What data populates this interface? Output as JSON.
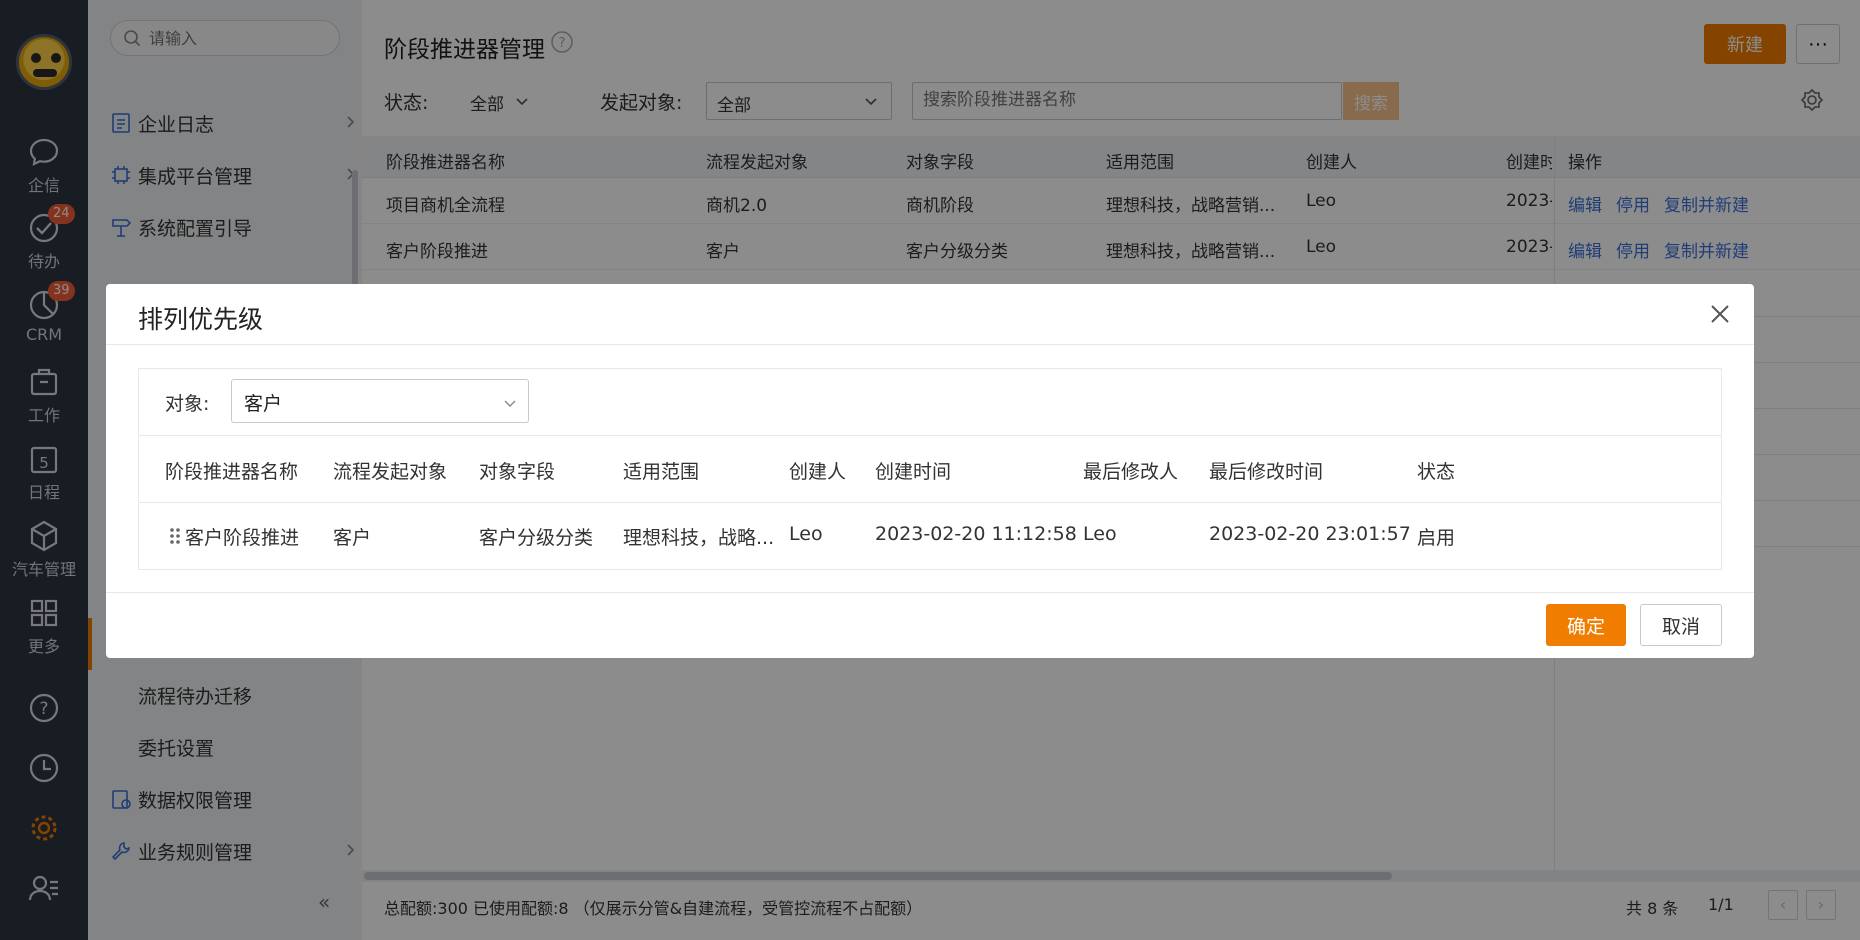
{
  "rail": {
    "items": [
      {
        "label": "企信",
        "icon": "chat-icon"
      },
      {
        "label": "待办",
        "icon": "todo-check-icon",
        "badge": "24"
      },
      {
        "label": "CRM",
        "icon": "crm-pie-icon",
        "badge": "39"
      },
      {
        "label": "工作",
        "icon": "briefcase-icon"
      },
      {
        "label": "日程",
        "icon": "calendar-icon"
      },
      {
        "label": "汽车管理",
        "icon": "cube-icon"
      },
      {
        "label": "更多",
        "icon": "grid-icon"
      }
    ]
  },
  "sidebar": {
    "search_placeholder": "请输入",
    "items_top": [
      {
        "label": "企业日志"
      },
      {
        "label": "集成平台管理"
      },
      {
        "label": "系统配置引导"
      }
    ],
    "items_bottom": [
      {
        "label": "流程待办迁移"
      },
      {
        "label": "委托设置"
      },
      {
        "label": "数据权限管理"
      },
      {
        "label": "业务规则管理"
      }
    ],
    "collapse": "«"
  },
  "main": {
    "title": "阶段推进器管理",
    "new_button": "新建",
    "more_button": "···",
    "status_label": "状态:",
    "status_value": "全部",
    "initiator_label": "发起对象:",
    "initiator_value": "全部",
    "search_placeholder": "搜索阶段推进器名称",
    "search_button": "搜索",
    "columns": [
      "阶段推进器名称",
      "流程发起对象",
      "对象字段",
      "适用范围",
      "创建人",
      "创建时",
      "操作"
    ],
    "rows": [
      {
        "name": "项目商机全流程",
        "initiator": "商机2.0",
        "field": "商机阶段",
        "scope": "理想科技，战略营销...",
        "creator": "Leo",
        "created": "2023-0"
      },
      {
        "name": "客户阶段推进",
        "initiator": "客户",
        "field": "客户分级分类",
        "scope": "理想科技，战略营销...",
        "creator": "Leo",
        "created": "2023-0"
      }
    ],
    "actions": {
      "edit": "编辑",
      "disable": "停用",
      "copy": "复制并新建"
    },
    "footer_note": "总配额:300 已使用配额:8 （仅展示分管&自建流程，受管控流程不占配额）",
    "footer_count": "共 8 条",
    "footer_page": "1/1"
  },
  "modal": {
    "title": "排列优先级",
    "object_label": "对象:",
    "object_value": "客户",
    "columns": [
      "阶段推进器名称",
      "流程发起对象",
      "对象字段",
      "适用范围",
      "创建人",
      "创建时间",
      "最后修改人",
      "最后修改时间",
      "状态"
    ],
    "row": {
      "name": "客户阶段推进",
      "initiator": "客户",
      "field": "客户分级分类",
      "scope": "理想科技，战略...",
      "creator": "Leo",
      "created": "2023-02-20 11:12:58",
      "modifier": "Leo",
      "modified": "2023-02-20 23:01:57",
      "status": "启用"
    },
    "ok": "确定",
    "cancel": "取消"
  },
  "colors": {
    "accent": "#f07d00",
    "link": "#3b6fd8",
    "rail": "#2d3340",
    "badge": "#f25c3a"
  }
}
